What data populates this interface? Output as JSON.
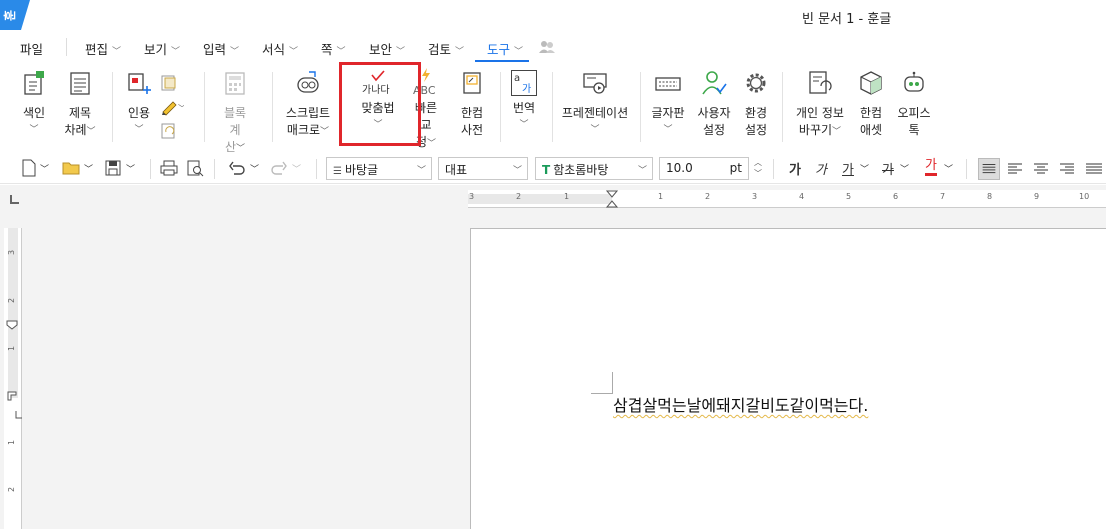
{
  "window": {
    "logo_text": "훈",
    "title": "빈 문서 1 - 훈글"
  },
  "menu": {
    "file": "파일",
    "items": [
      "편집",
      "보기",
      "입력",
      "서식",
      "쪽",
      "보안",
      "검토",
      "도구"
    ],
    "active": "도구"
  },
  "ribbon": {
    "index": {
      "line1": "색인",
      "line2": ""
    },
    "toc": {
      "line1": "제목",
      "line2": "차례"
    },
    "cite": {
      "line1": "인용",
      "line2": ""
    },
    "block_calc": {
      "line1": "블록",
      "line2": "계산"
    },
    "script_macro": {
      "line1": "스크립트",
      "line2": "매크로"
    },
    "spellcheck": {
      "line1": "맞춤법",
      "icon_text": "가나다"
    },
    "quick_correct": {
      "line1": "빠른",
      "line2": "교정",
      "icon_text": "ABC"
    },
    "hancom_dict": {
      "line1": "한컴",
      "line2": "사전"
    },
    "translate": {
      "line1": "번역",
      "icon_text1": "a",
      "icon_text2": "가"
    },
    "presentation": {
      "line1": "프레젠테이션"
    },
    "char_map": {
      "line1": "글자판"
    },
    "user_settings": {
      "line1": "사용자",
      "line2": "설정"
    },
    "env_settings": {
      "line1": "환경",
      "line2": "설정"
    },
    "privacy": {
      "line1": "개인 정보",
      "line2": "바꾸기"
    },
    "hancom_asset": {
      "line1": "한컴",
      "line2": "애셋"
    },
    "office_talk": {
      "line1": "오피스",
      "line2": "톡"
    }
  },
  "toolbar": {
    "style": "바탕글",
    "para_style": "대표",
    "font": "함초롬바탕",
    "font_size": "10.0",
    "size_unit": "pt",
    "bold": "가",
    "italic": "가",
    "underline": "가",
    "strike": "가",
    "font_color": "가"
  },
  "ruler": {
    "h_numbers": [
      "3",
      "2",
      "1",
      "1",
      "2",
      "3",
      "4",
      "5",
      "6",
      "7",
      "8",
      "9",
      "10"
    ],
    "v_numbers": [
      "3",
      "2",
      "1",
      "1",
      "2"
    ]
  },
  "document": {
    "text": "삼겹살먹는날에돼지갈비도같이먹는다."
  },
  "colors": {
    "accent": "#1a73e8",
    "highlight": "#e0262b",
    "logo": "#2a8ae8"
  }
}
